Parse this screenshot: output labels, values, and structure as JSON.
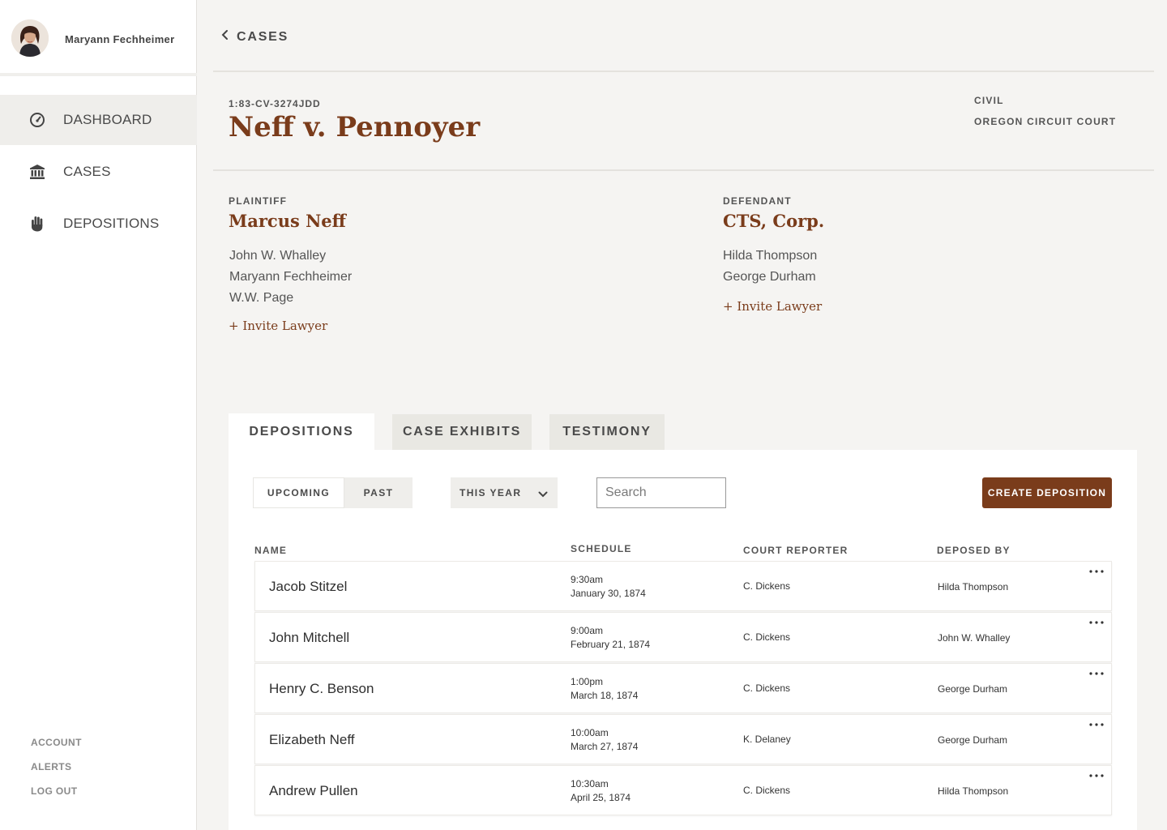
{
  "user": {
    "name": "Maryann Fechheimer"
  },
  "nav": {
    "items": [
      {
        "label": "DASHBOARD",
        "icon": "gauge-icon",
        "active": true
      },
      {
        "label": "CASES",
        "icon": "courthouse-icon",
        "active": false
      },
      {
        "label": "DEPOSITIONS",
        "icon": "raised-hand-icon",
        "active": false
      }
    ],
    "footer": [
      "ACCOUNT",
      "ALERTS",
      "LOG OUT"
    ]
  },
  "breadcrumb": {
    "back_label": "CASES"
  },
  "case": {
    "number": "1:83-CV-3274JDD",
    "title": "Neff v. Pennoyer",
    "type": "CIVIL",
    "court": "OREGON CIRCUIT COURT"
  },
  "plaintiff": {
    "label": "PLAINTIFF",
    "name": "Marcus Neff",
    "lawyers": [
      "John W. Whalley",
      "Maryann Fechheimer",
      "W.W. Page"
    ],
    "invite": "+ Invite Lawyer"
  },
  "defendant": {
    "label": "DEFENDANT",
    "name": "CTS, Corp.",
    "lawyers": [
      "Hilda Thompson",
      "George Durham"
    ],
    "invite": "+ Invite Lawyer"
  },
  "tabs": [
    {
      "label": "DEPOSITIONS",
      "active": true
    },
    {
      "label": "CASE EXHIBITS",
      "active": false
    },
    {
      "label": "TESTIMONY",
      "active": false
    }
  ],
  "filters": {
    "segments": [
      {
        "label": "UPCOMING",
        "active": true
      },
      {
        "label": "PAST",
        "active": false
      }
    ],
    "period": "THIS YEAR",
    "search_placeholder": "Search",
    "create_label": "CREATE DEPOSITION"
  },
  "table": {
    "columns": [
      "NAME",
      "SCHEDULE",
      "COURT REPORTER",
      "DEPOSED BY"
    ],
    "rows": [
      {
        "name": "Jacob Stitzel",
        "time": "9:30am",
        "date": "January 30, 1874",
        "reporter": "C. Dickens",
        "deposed_by": "Hilda Thompson"
      },
      {
        "name": "John Mitchell",
        "time": "9:00am",
        "date": "February 21, 1874",
        "reporter": "C. Dickens",
        "deposed_by": "John W. Whalley"
      },
      {
        "name": "Henry C. Benson",
        "time": "1:00pm",
        "date": "March 18, 1874",
        "reporter": "C. Dickens",
        "deposed_by": "George Durham"
      },
      {
        "name": "Elizabeth Neff",
        "time": "10:00am",
        "date": "March 27, 1874",
        "reporter": "K. Delaney",
        "deposed_by": "George Durham"
      },
      {
        "name": "Andrew Pullen",
        "time": "10:30am",
        "date": "April 25, 1874",
        "reporter": "C. Dickens",
        "deposed_by": "Hilda Thompson"
      }
    ]
  },
  "colors": {
    "accent": "#7a3c1b",
    "background": "#f5f4f2",
    "sidebar": "#ffffff"
  }
}
